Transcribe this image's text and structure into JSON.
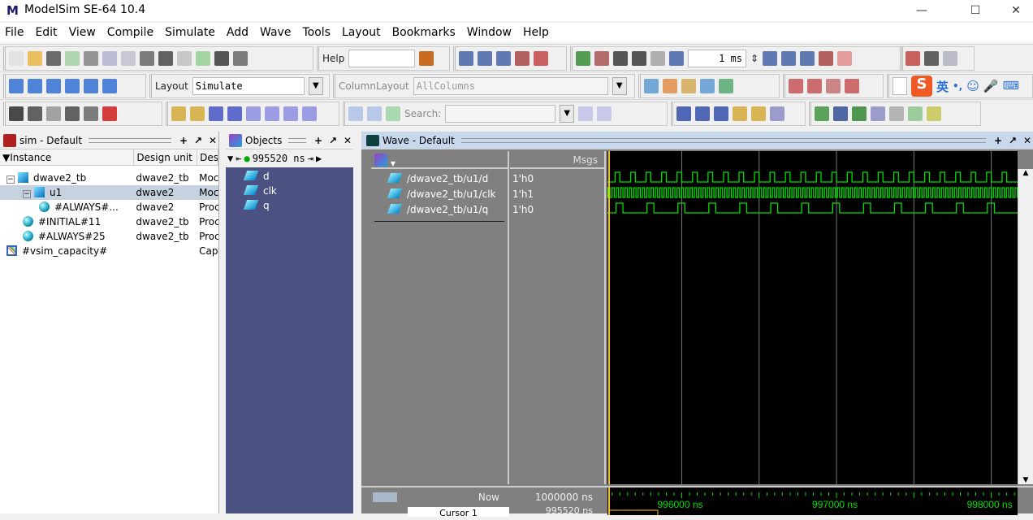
{
  "window": {
    "title": "ModelSim SE-64 10.4",
    "logo": "M"
  },
  "menu": [
    "File",
    "Edit",
    "View",
    "Compile",
    "Simulate",
    "Add",
    "Wave",
    "Tools",
    "Layout",
    "Bookmarks",
    "Window",
    "Help"
  ],
  "toolbar": {
    "help_label": "Help",
    "help_value": "",
    "layout_label": "Layout",
    "layout_value": "Simulate",
    "column_layout_label": "ColumnLayout",
    "column_layout_value": "AllColumns",
    "search_label": "Search:",
    "search_value": "",
    "run_length": "1 ms",
    "ime": {
      "logo": "S",
      "lang": "英",
      "punct": "•,"
    }
  },
  "sim_panel": {
    "title": "sim - Default",
    "columns": [
      "Instance",
      "Design unit",
      "Des"
    ],
    "rows": [
      {
        "instance": "dwave2_tb",
        "unit": "dwave2_tb",
        "type": "Moc",
        "level": 0,
        "icon": "module",
        "expand": "−"
      },
      {
        "instance": "u1",
        "unit": "dwave2",
        "type": "Moc",
        "level": 1,
        "icon": "module",
        "expand": "−",
        "selected": true
      },
      {
        "instance": "#ALWAYS#...",
        "unit": "dwave2",
        "type": "Proc",
        "level": 2,
        "icon": "process"
      },
      {
        "instance": "#INITIAL#11",
        "unit": "dwave2_tb",
        "type": "Proc",
        "level": 1,
        "icon": "process"
      },
      {
        "instance": "#ALWAYS#25",
        "unit": "dwave2_tb",
        "type": "Proc",
        "level": 1,
        "icon": "process"
      },
      {
        "instance": "#vsim_capacity#",
        "unit": "",
        "type": "Cap",
        "level": 0,
        "icon": "capacity"
      }
    ]
  },
  "objects_panel": {
    "title": "Objects",
    "time": "995520 ns",
    "items": [
      "d",
      "clk",
      "q"
    ]
  },
  "wave_panel": {
    "title": "Wave - Default",
    "msgs_label": "Msgs",
    "signals": [
      {
        "name": "/dwave2_tb/u1/d",
        "value": "1'h0",
        "period_ns": 100,
        "high_ns": 30,
        "first_rise_ns": 995570
      },
      {
        "name": "/dwave2_tb/u1/clk",
        "value": "1'h1",
        "period_ns": 28,
        "high_ns": 14,
        "first_rise_ns": 995522
      },
      {
        "name": "/dwave2_tb/u1/q",
        "value": "1'h0",
        "period_ns": 200,
        "high_ns": 45,
        "first_rise_ns": 995575
      }
    ],
    "view_range_ns": [
      995520,
      998170
    ],
    "ticks": [
      "996000 ns",
      "997000 ns",
      "998000 ns"
    ],
    "now_label": "Now",
    "now_value": "1000000 ns",
    "cursor_label": "Cursor 1",
    "cursor_value": "995520 ns",
    "cursor_ns": 995520,
    "wave_color": "#00e000",
    "cursor_color": "#ffc000"
  }
}
